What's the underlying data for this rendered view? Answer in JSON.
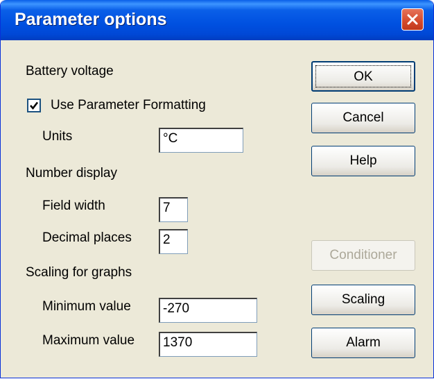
{
  "window": {
    "title": "Parameter options"
  },
  "labels": {
    "parameter_name": "Battery voltage",
    "use_formatting": "Use Parameter Formatting",
    "units": "Units",
    "number_display": "Number display",
    "field_width": "Field width",
    "decimal_places": "Decimal places",
    "scaling_for_graphs": "Scaling for graphs",
    "minimum_value": "Minimum value",
    "maximum_value": "Maximum value"
  },
  "fields": {
    "units": "°C",
    "field_width": "7",
    "decimal_places": "2",
    "minimum_value": "-270",
    "maximum_value": "1370"
  },
  "checkbox": {
    "use_formatting_checked": true
  },
  "buttons": {
    "ok": "OK",
    "cancel": "Cancel",
    "help": "Help",
    "conditioner": "Conditioner",
    "scaling": "Scaling",
    "alarm": "Alarm"
  },
  "icons": {
    "close": "close-icon",
    "check": "checkmark-icon"
  }
}
